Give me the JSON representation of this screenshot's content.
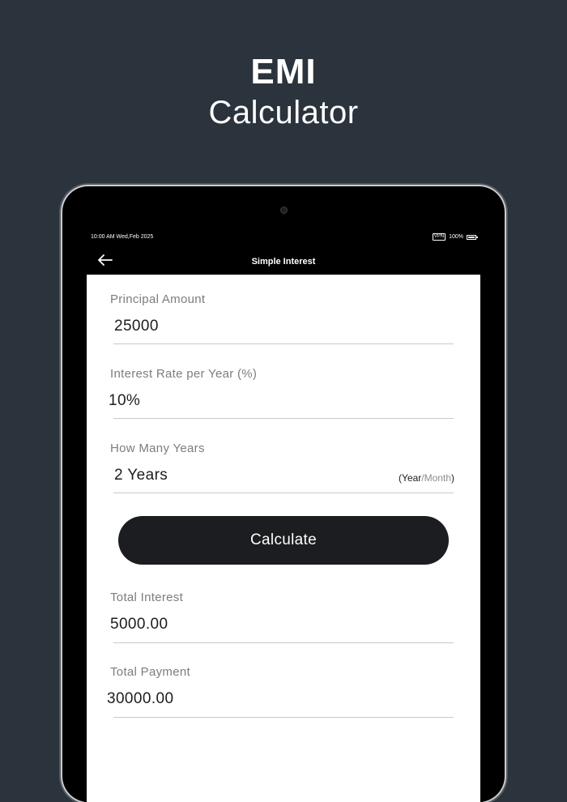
{
  "promo": {
    "title_line1": "EMI",
    "title_line2": "Calculator"
  },
  "status_bar": {
    "time": "10:00 AM Wed,Feb 2025",
    "vpn": "VPN",
    "battery": "100%"
  },
  "app_bar": {
    "title": "Simple Interest"
  },
  "form": {
    "principal": {
      "label": "Principal Amount",
      "value": "25000"
    },
    "rate": {
      "label": "Interest Rate per Year (%)",
      "value": "10%"
    },
    "years": {
      "label": "How Many Years",
      "value": "2 Years",
      "unit_open": "(",
      "unit_year": "Year",
      "unit_sep": "/",
      "unit_month": "Month",
      "unit_close": ")"
    }
  },
  "calculate_label": "Calculate",
  "results": {
    "total_interest": {
      "label": "Total Interest",
      "value": "5000.00"
    },
    "total_payment": {
      "label": "Total Payment",
      "value": "30000.00"
    }
  },
  "colors": {
    "page_bg": "#2b333c",
    "button_bg": "#1b1d20",
    "label": "#7a7d82"
  }
}
